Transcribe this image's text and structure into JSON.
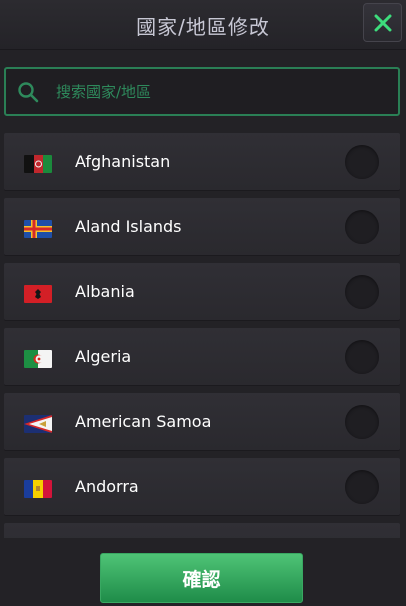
{
  "header": {
    "title": "國家/地區修改",
    "close_icon": "close-icon"
  },
  "search": {
    "placeholder": "搜索國家/地區",
    "value": "",
    "icon": "search-icon"
  },
  "countries": [
    {
      "name": "Afghanistan",
      "flag": "afghanistan-flag",
      "selected": false
    },
    {
      "name": "Aland Islands",
      "flag": "aland-islands-flag",
      "selected": false
    },
    {
      "name": "Albania",
      "flag": "albania-flag",
      "selected": false
    },
    {
      "name": "Algeria",
      "flag": "algeria-flag",
      "selected": false
    },
    {
      "name": "American Samoa",
      "flag": "american-samoa-flag",
      "selected": false
    },
    {
      "name": "Andorra",
      "flag": "andorra-flag",
      "selected": false
    }
  ],
  "footer": {
    "confirm_label": "確認"
  },
  "colors": {
    "accent": "#2a7f55",
    "button_top": "#4fc476",
    "button_bottom": "#1f8c49",
    "background": "#232226"
  }
}
